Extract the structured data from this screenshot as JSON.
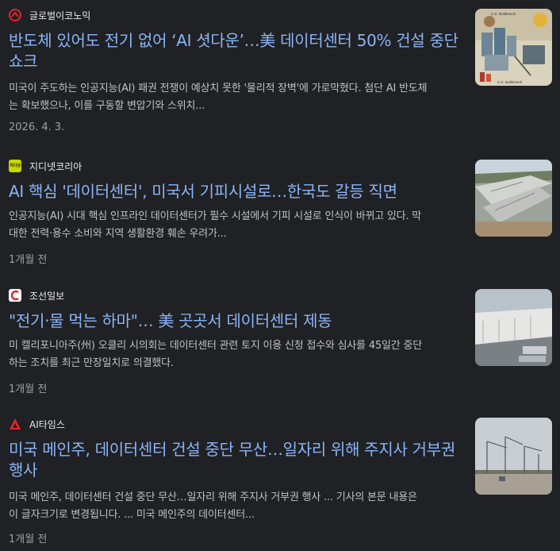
{
  "articles": [
    {
      "source": "글로벌이코노믹",
      "logo_icon": "globaleconomic-logo-icon",
      "logo_color": "#e0262b",
      "title_line1": "반도체 있어도 전기 없어 ‘AI 셧다운’…美 데이터센터 50% 건설 중단",
      "title_line2": "쇼크",
      "snippet_line1": "미국이 주도하는 인공지능(AI) 패권 전쟁이 예상치 못한 '물리적 장벽'에 가로막혔다. 첨단 AI 반도체",
      "snippet_line2": "는 확보했으나, 이를 구동할 변압기와 스위치...",
      "date": "2026. 4. 3.",
      "thumb_icon": "datacenter-illustration-image",
      "thumb_labels": [
        "U.S. Bottleneck",
        "U.S. Bottleneck"
      ]
    },
    {
      "source": "지디넷코리아",
      "logo_icon": "zdnet-korea-logo-icon",
      "logo_color": "#c7d900",
      "logo_text": "지디넷",
      "title_line1": "AI 핵심 '데이터센터', 미국서 기피시설로…한국도 갈등 직면",
      "snippet_line1": "인공지능(AI) 시대 핵심 인프라인 데이터센터가 필수 시설에서 기피 시설로 인식이 바뀌고 있다. 막",
      "snippet_line2": "대한 전력·용수 소비와 지역 생활환경 훼손 우려가...",
      "date": "1개월 전",
      "thumb_icon": "datacenter-construction-aerial-image"
    },
    {
      "source": "조선일보",
      "logo_icon": "chosun-logo-icon",
      "logo_color": "#e0262b",
      "title_line1": "\"전기·물 먹는 하마\"… 美 곳곳서 데이터센터 제동",
      "snippet_line1": "미 캘리포니아주(州) 오클리 시의회는 데이터센터 관련 토지 이용 신청 접수와 심사를 45일간 중단",
      "snippet_line2": "하는 조치를 최근 만장일치로 의결했다.",
      "date": "1개월 전",
      "thumb_icon": "datacenter-building-image"
    },
    {
      "source": "AI타임스",
      "logo_icon": "aitimes-logo-icon",
      "logo_color": "#e0262b",
      "title_line1": "미국 메인주, 데이터센터 건설 중단 무산…일자리 위해 주지사 거부권",
      "title_line2": "행사",
      "snippet_line1": "미국 메인주, 데이터센터 건설 중단 무산…일자리 위해 주지사 거부권 행사 ... 기사의 본문 내용은",
      "snippet_line2": "이 글자크기로 변경됩니다. ... 미국 메인주의 데이터센터...",
      "date": "1개월 전",
      "thumb_icon": "construction-site-cranes-image"
    }
  ]
}
